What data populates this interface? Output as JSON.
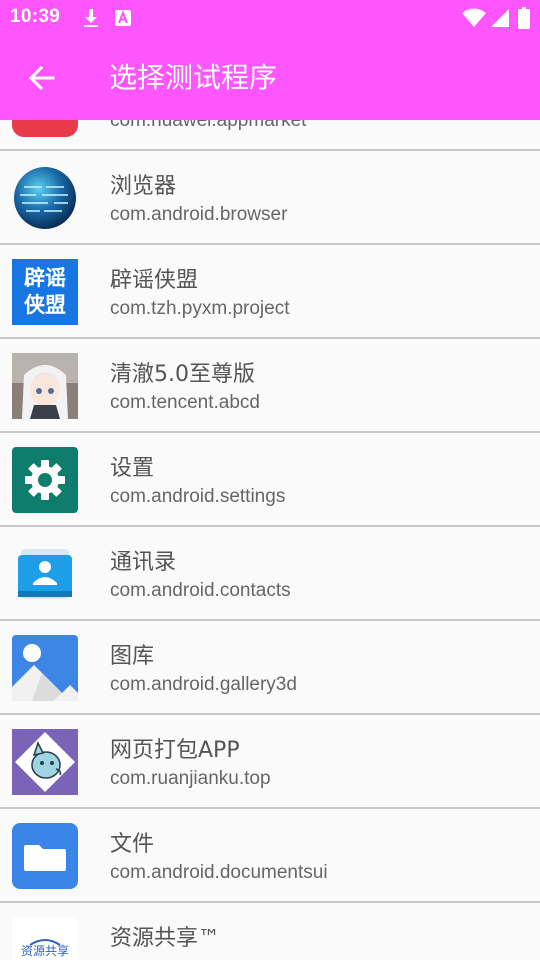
{
  "status": {
    "time": "10:39"
  },
  "toolbar": {
    "title": "选择测试程序"
  },
  "apps": [
    {
      "name": "",
      "package": "com.huawei.appmarket",
      "icon": "app-market-icon"
    },
    {
      "name": "浏览器",
      "package": "com.android.browser",
      "icon": "globe-icon"
    },
    {
      "name": "辟谣侠盟",
      "package": "com.tzh.pyxm.project",
      "icon": "piyao-xiameng-icon",
      "icon_text": [
        "辟谣",
        "侠盟"
      ]
    },
    {
      "name": "清澈5.0至尊版",
      "package": "com.tencent.abcd",
      "icon": "anime-avatar-icon"
    },
    {
      "name": "设置",
      "package": "com.android.settings",
      "icon": "gear-icon"
    },
    {
      "name": "通讯录",
      "package": "com.android.contacts",
      "icon": "contacts-icon"
    },
    {
      "name": "图库",
      "package": "com.android.gallery3d",
      "icon": "gallery-icon"
    },
    {
      "name": "网页打包APP",
      "package": "com.ruanjianku.top",
      "icon": "cartoon-dog-icon"
    },
    {
      "name": "文件",
      "package": "com.android.documentsui",
      "icon": "folder-icon"
    },
    {
      "name": "资源共享™",
      "package": "",
      "icon": "resource-share-logo-icon",
      "icon_text": "资源共享"
    }
  ],
  "colors": {
    "appbar": "#ff55ff",
    "divider": "#c8c8c8",
    "background": "#fafafa"
  }
}
